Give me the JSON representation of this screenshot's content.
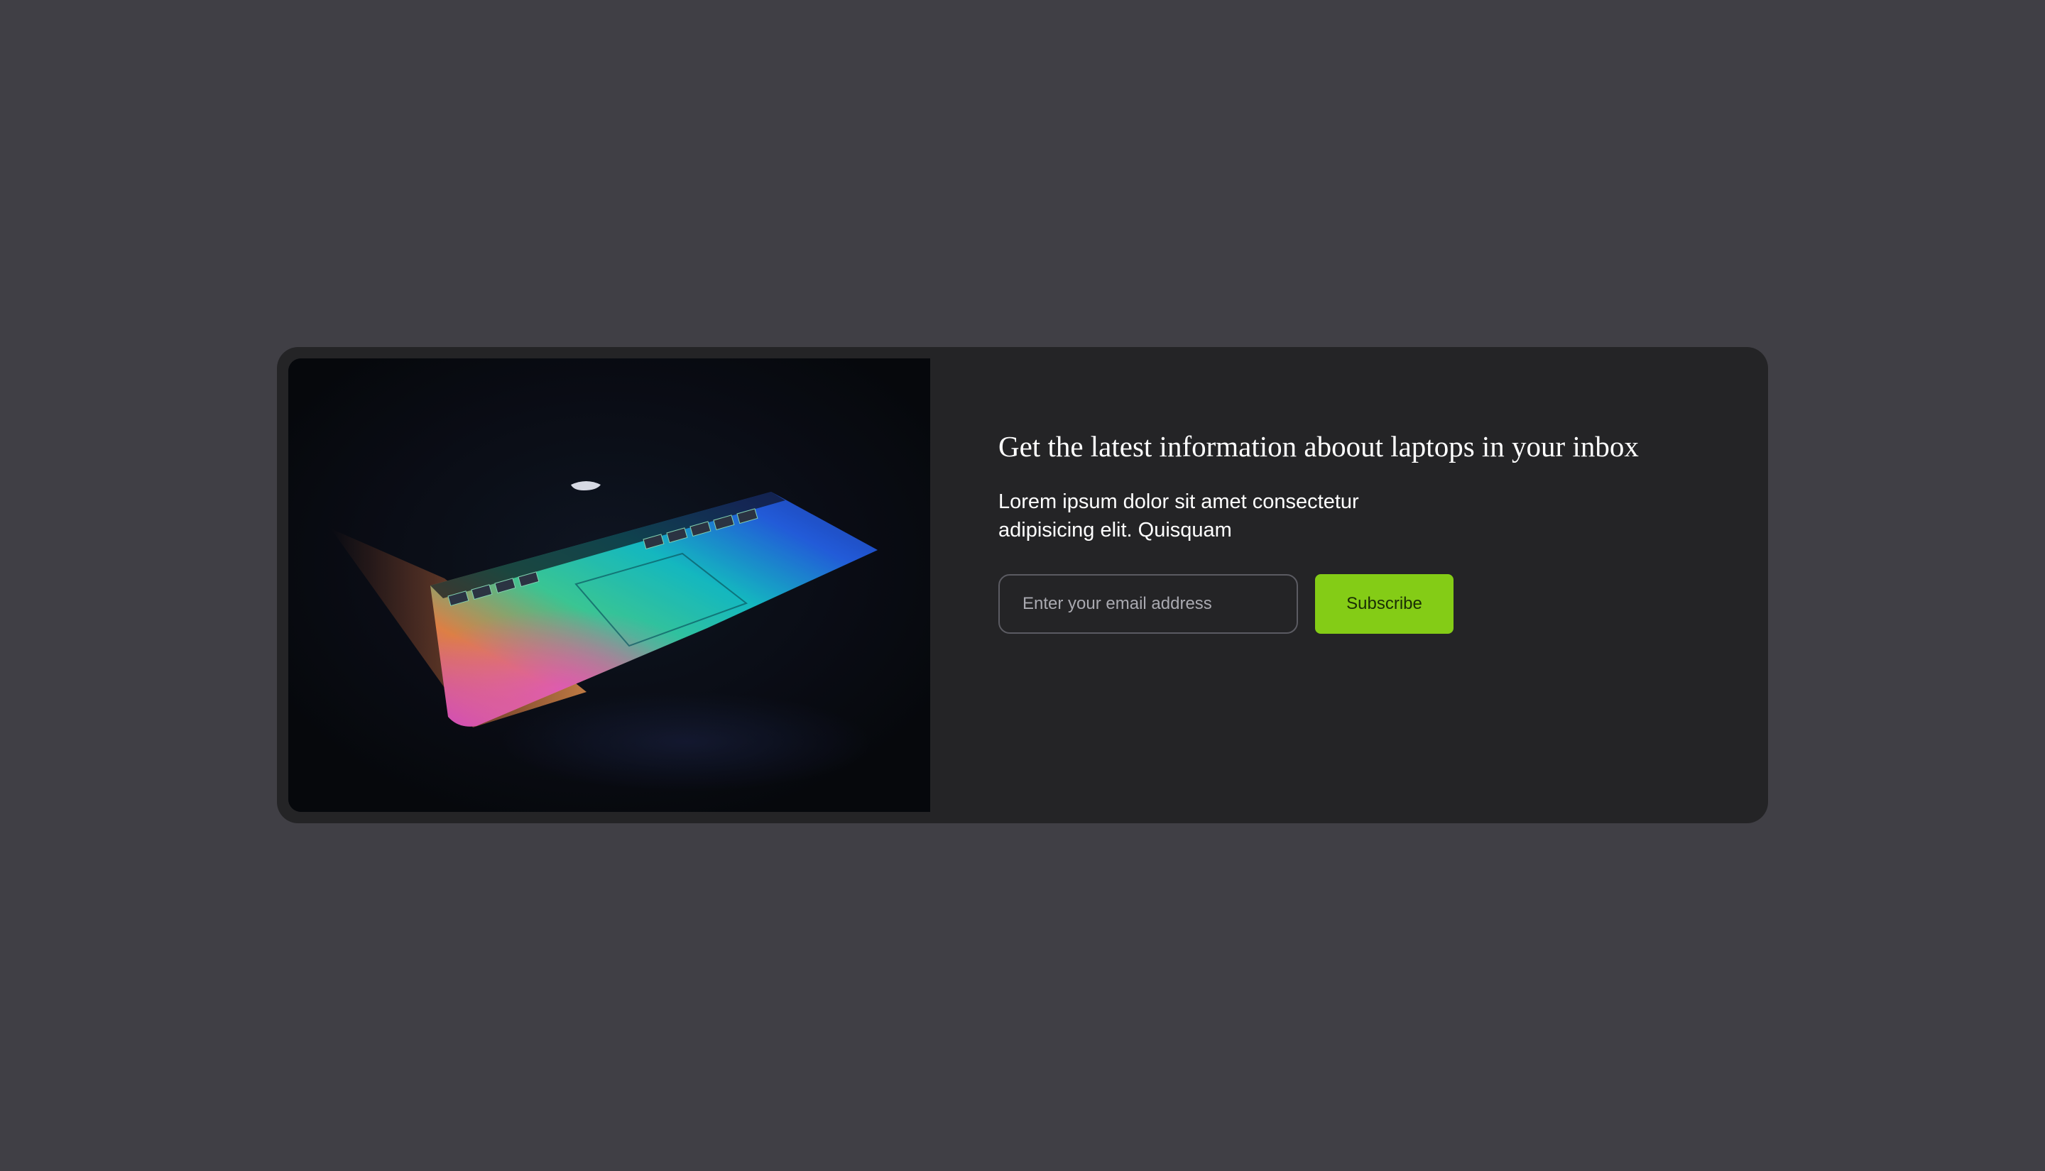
{
  "newsletter": {
    "headline": "Get the latest information aboout laptops in your inbox",
    "body": "Lorem ipsum dolor sit amet consectetur adipisicing elit. Quisquam",
    "email_placeholder": "Enter your email address",
    "subscribe_label": "Subscribe"
  },
  "colors": {
    "page_background": "#403f45",
    "card_background": "#242426",
    "accent": "#84cc16"
  }
}
